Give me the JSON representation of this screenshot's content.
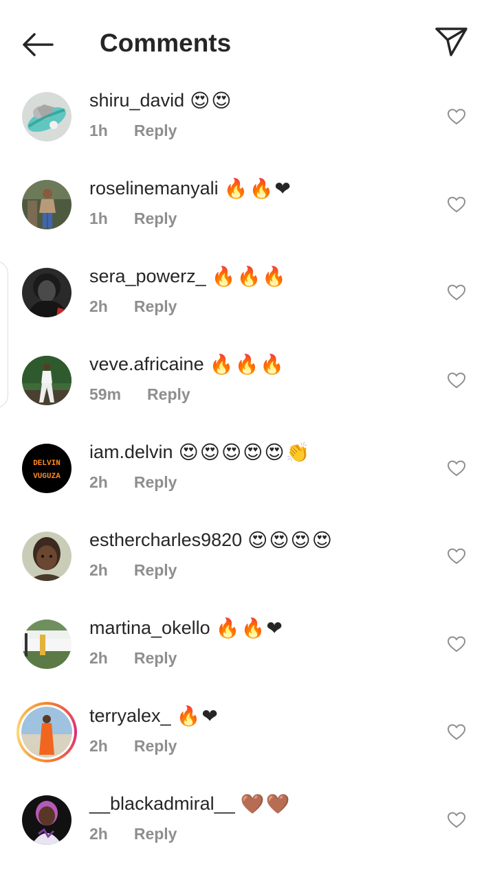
{
  "header": {
    "title": "Comments",
    "back_icon": "arrow-left-icon",
    "send_icon": "paper-plane-icon"
  },
  "comments": [
    {
      "username": "shiru_david",
      "emojis": "😍😍",
      "time": "1h",
      "reply": "Reply"
    },
    {
      "username": "roselinemanyali",
      "emojis": "🔥🔥❤",
      "time": "1h",
      "reply": "Reply"
    },
    {
      "username": "sera_powerz_",
      "emojis": "🔥🔥🔥",
      "time": "2h",
      "reply": "Reply"
    },
    {
      "username": "veve.africaine",
      "emojis": "🔥🔥🔥",
      "time": "59m",
      "reply": "Reply"
    },
    {
      "username": "iam.delvin",
      "emojis": "😍😍😍😍😍👏",
      "time": "2h",
      "reply": "Reply"
    },
    {
      "username": "esthercharles9820",
      "emojis": "😍😍😍😍",
      "time": "2h",
      "reply": "Reply"
    },
    {
      "username": "martina_okello",
      "emojis": "🔥🔥❤",
      "time": "2h",
      "reply": "Reply"
    },
    {
      "username": "terryalex_",
      "emojis": "🔥❤",
      "time": "2h",
      "reply": "Reply"
    },
    {
      "username": "__blackadmiral__",
      "emojis": "🤎🤎",
      "time": "2h",
      "reply": "Reply"
    }
  ],
  "avatar_texts": {
    "delvin_top": "DELVIN",
    "delvin_bottom": "VUGUZA"
  },
  "colors": {
    "text": "#262626",
    "meta": "#8e8e8e",
    "story_ring": "#dd2a7b"
  }
}
